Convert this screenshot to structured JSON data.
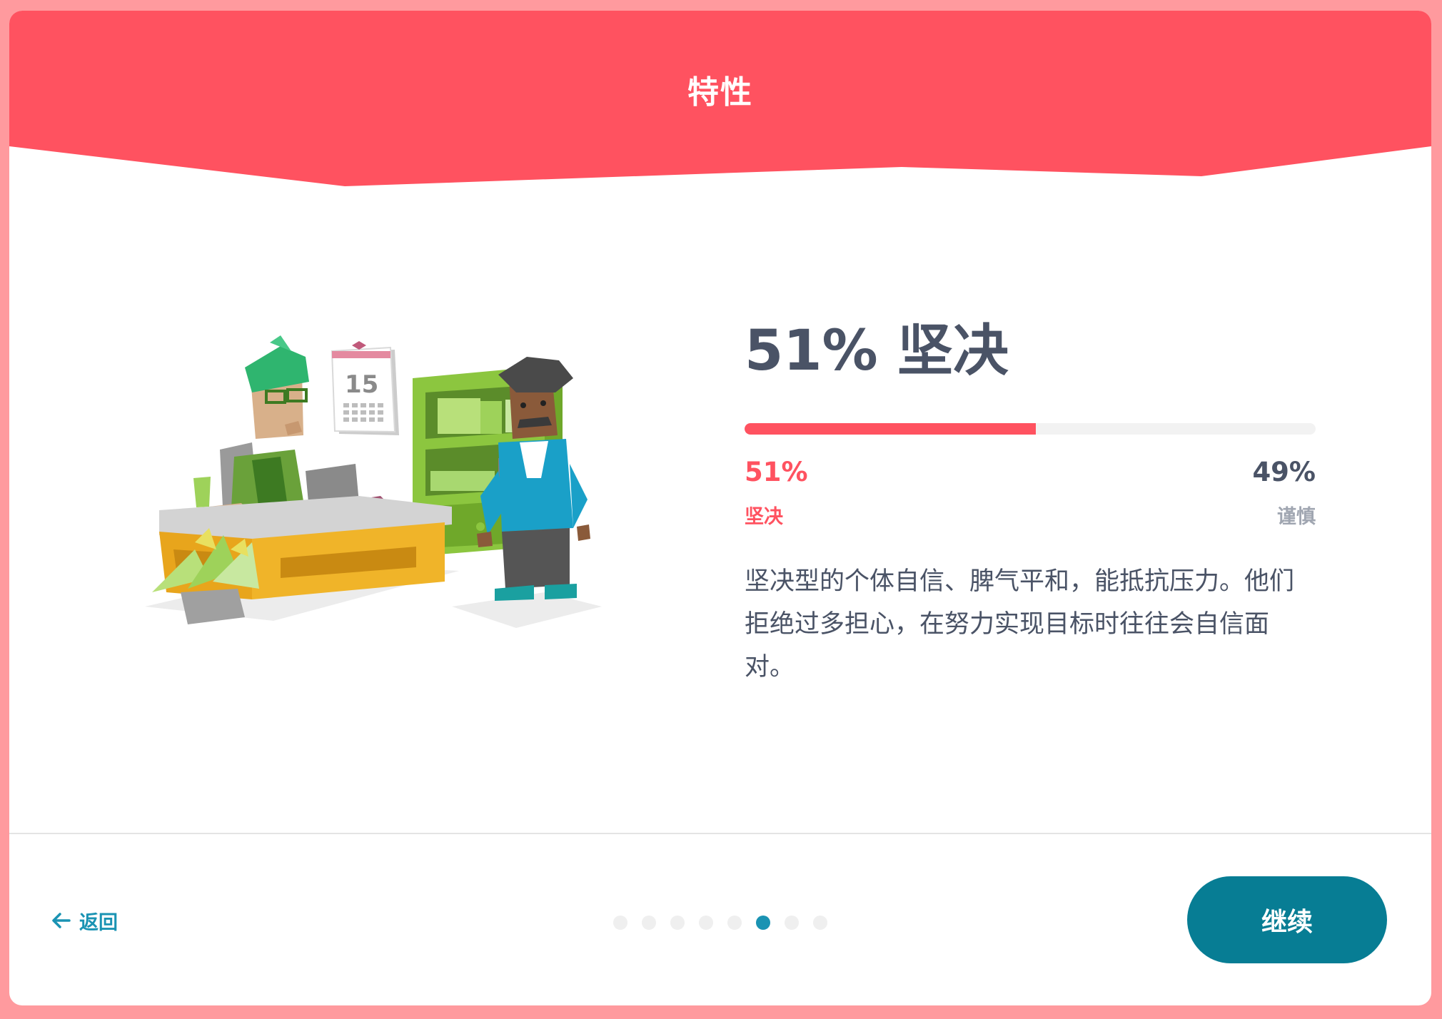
{
  "header": {
    "title": "特性"
  },
  "trait": {
    "title": "51% 坚决",
    "progress_fraction": 0.51,
    "left_percent": "51%",
    "left_label": "坚决",
    "right_percent": "49%",
    "right_label": "谨慎",
    "description": "坚决型的个体自信、脾气平和，能抵抗压力。他们拒绝过多担心，在努力实现目标时往往会自信面对。"
  },
  "calendar": {
    "day": "15"
  },
  "footer": {
    "back_label": "返回",
    "continue_label": "继续",
    "pagination": {
      "total": 8,
      "active_index": 5
    }
  },
  "colors": {
    "accent": "#ff5260",
    "primary_button": "#077d94",
    "link": "#1a93b3",
    "text_dark": "#4a5366",
    "text_muted": "#a0a6b1",
    "background": "#ff9a9e"
  }
}
